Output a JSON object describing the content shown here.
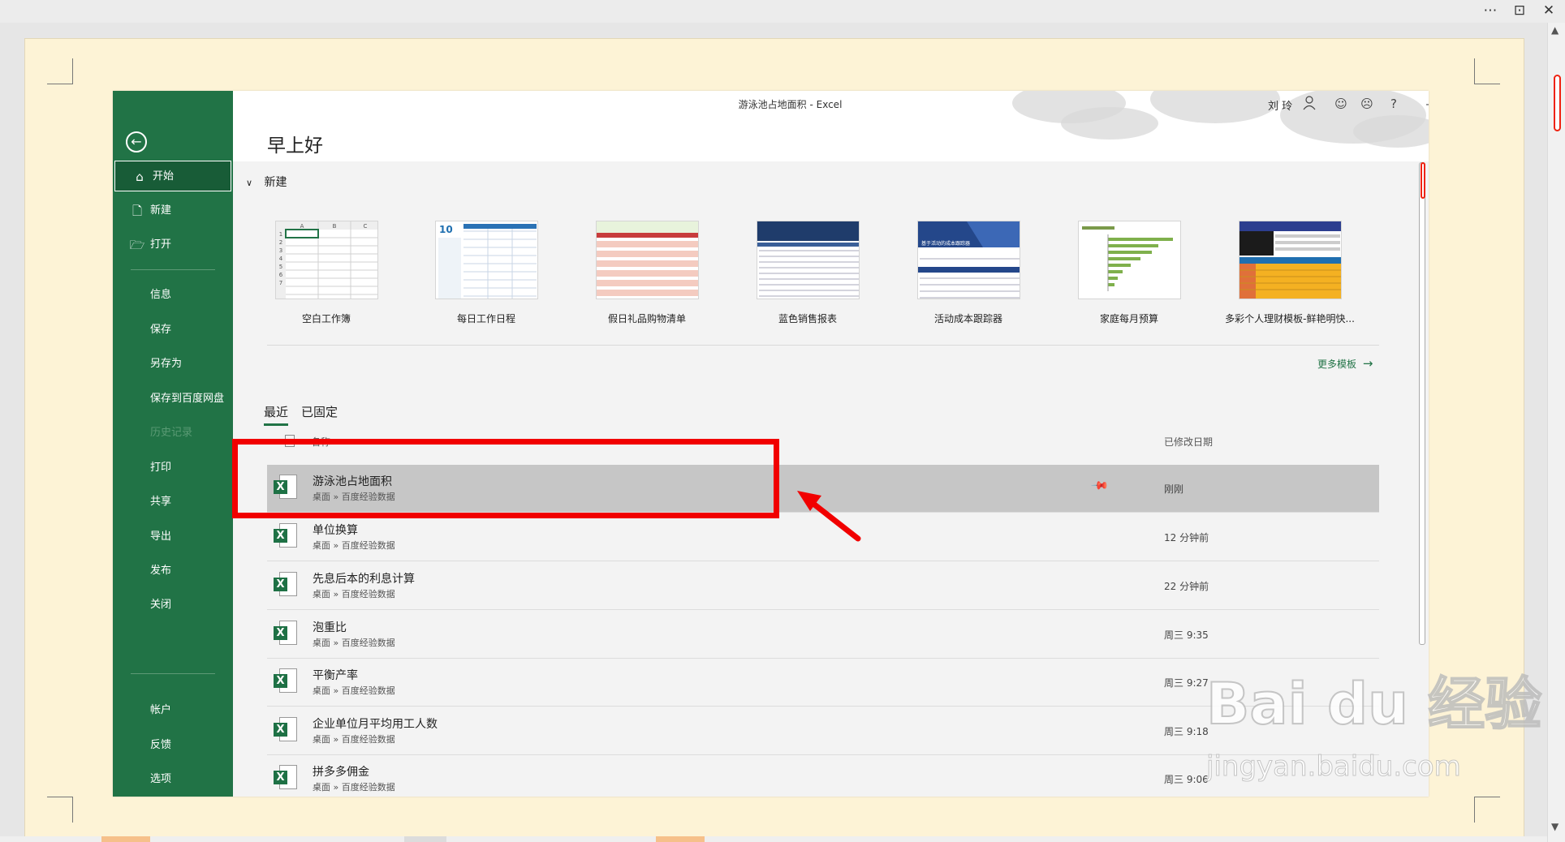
{
  "window": {
    "title": "游泳池占地面积",
    "app": "Excel",
    "title_sep": "-",
    "user": "刘 玲",
    "icons": [
      "person-icon",
      "smile-icon",
      "frown-icon",
      "help-icon",
      "minimize-icon",
      "restore-icon",
      "close-icon"
    ],
    "help_glyph": "?"
  },
  "greeting": "早上好",
  "sidebar": {
    "items": [
      {
        "label": "开始",
        "icon": "home-icon",
        "active": true
      },
      {
        "label": "新建",
        "icon": "new-doc-icon"
      },
      {
        "label": "打开",
        "icon": "open-folder-icon"
      },
      {
        "label": "信息"
      },
      {
        "label": "保存"
      },
      {
        "label": "另存为"
      },
      {
        "label": "保存到百度网盘"
      },
      {
        "label": "历史记录",
        "disabled": true
      },
      {
        "label": "打印"
      },
      {
        "label": "共享"
      },
      {
        "label": "导出"
      },
      {
        "label": "发布"
      },
      {
        "label": "关闭"
      },
      {
        "label": "帐户"
      },
      {
        "label": "反馈"
      },
      {
        "label": "选项"
      }
    ]
  },
  "new_section": {
    "label": "新建",
    "templates": [
      {
        "name": "空白工作簿",
        "thumb": "blank-grid"
      },
      {
        "name": "每日工作日程",
        "thumb": "schedule",
        "thumb_text": "10"
      },
      {
        "name": "假日礼品购物清单",
        "thumb": "gift-list"
      },
      {
        "name": "蓝色销售报表",
        "thumb": "blue-sales"
      },
      {
        "name": "活动成本跟踪器",
        "thumb": "cost-tracker",
        "thumb_text": "基于活动的成本跟踪器"
      },
      {
        "name": "家庭每月预算",
        "thumb": "budget"
      },
      {
        "name": "多彩个人理财模板-鲜艳明快...",
        "thumb": "finance"
      }
    ],
    "blank_cols": [
      "A",
      "B",
      "C"
    ],
    "blank_rows": [
      "1",
      "2",
      "3",
      "4",
      "5",
      "6",
      "7"
    ],
    "more_label": "更多模板",
    "more_arrow": "→"
  },
  "tabs": [
    {
      "label": "最近",
      "active": true
    },
    {
      "label": "已固定"
    }
  ],
  "columns": {
    "name": "名称",
    "date": "已修改日期"
  },
  "files": [
    {
      "name": "游泳池占地面积",
      "path": "桌面 » 百度经验数据",
      "date": "刚刚",
      "selected": true
    },
    {
      "name": "单位换算",
      "path": "桌面 » 百度经验数据",
      "date": "12 分钟前"
    },
    {
      "name": "先息后本的利息计算",
      "path": "桌面 » 百度经验数据",
      "date": "22 分钟前"
    },
    {
      "name": "泡重比",
      "path": "桌面 » 百度经验数据",
      "date": "周三 9:35"
    },
    {
      "name": "平衡产率",
      "path": "桌面 » 百度经验数据",
      "date": "周三 9:27"
    },
    {
      "name": "企业单位月平均用工人数",
      "path": "桌面 » 百度经验数据",
      "date": "周三 9:18"
    },
    {
      "name": "拼多多佣金",
      "path": "桌面 » 百度经验数据",
      "date": "周三 9:06"
    }
  ],
  "file_icon_letter": "X",
  "watermark": {
    "big": "Bai du 经验",
    "small": "jingyan.baidu.com"
  },
  "colors": {
    "excel_green": "#217346",
    "annotation_red": "#f10000",
    "page_bg": "#fdf3d6"
  }
}
